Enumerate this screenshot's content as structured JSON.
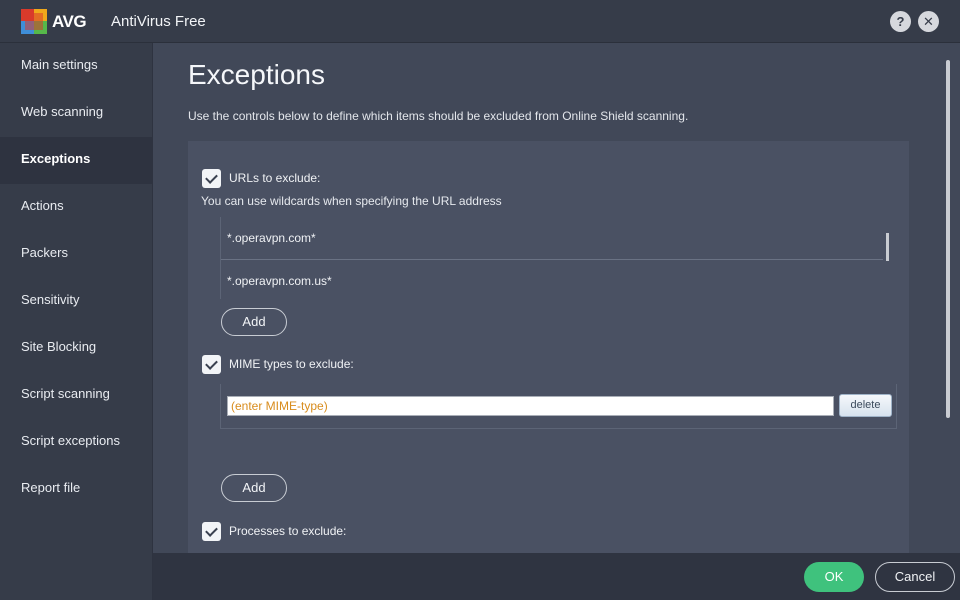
{
  "titlebar": {
    "logo_text": "AVG",
    "app_title": "AntiVirus Free",
    "help_label": "?",
    "close_label": "✕"
  },
  "sidebar": {
    "items": [
      {
        "label": "Main settings"
      },
      {
        "label": "Web scanning"
      },
      {
        "label": "Exceptions"
      },
      {
        "label": "Actions"
      },
      {
        "label": "Packers"
      },
      {
        "label": "Sensitivity"
      },
      {
        "label": "Site Blocking"
      },
      {
        "label": "Script scanning"
      },
      {
        "label": "Script exceptions"
      },
      {
        "label": "Report file"
      }
    ],
    "active_index": 2
  },
  "main": {
    "title": "Exceptions",
    "description": "Use the controls below to define which items should be excluded from Online Shield scanning.",
    "urls": {
      "checkbox_label": "URLs to exclude:",
      "checked": true,
      "hint": "You can use wildcards when specifying the URL address",
      "entries": [
        "*.operavpn.com*",
        "*.operavpn.com.us*"
      ],
      "add_label": "Add"
    },
    "mime": {
      "checkbox_label": "MIME types to exclude:",
      "checked": true,
      "input_placeholder": "(enter MIME-type)",
      "delete_label": "delete",
      "add_label": "Add"
    },
    "processes": {
      "checkbox_label": "Processes to exclude:",
      "checked": true
    }
  },
  "footer": {
    "ok_label": "OK",
    "cancel_label": "Cancel"
  },
  "colors": {
    "accent_ok": "#3fc27d",
    "sidebar_bg": "#363c49",
    "content_bg": "#414858",
    "placeholder_text": "#d88c1d"
  }
}
